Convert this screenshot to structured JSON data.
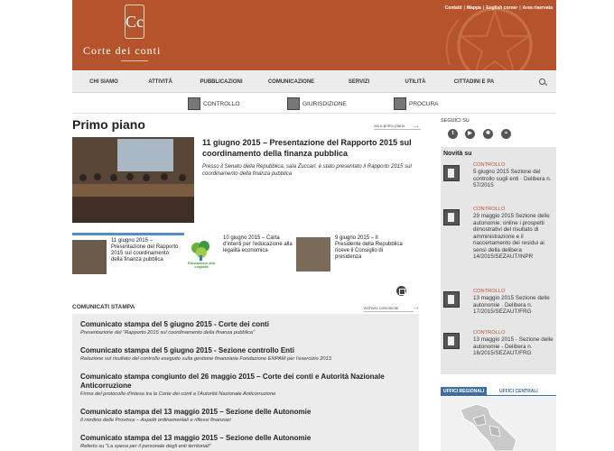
{
  "header": {
    "logo_mark": "Cc",
    "logo_text": "Corte dei conti",
    "top_links": [
      "Contatti",
      "Mappa",
      "English corner",
      "Area riservata"
    ],
    "brand_color": "#b5542c"
  },
  "nav": {
    "items": [
      "CHI SIAMO",
      "ATTIVITÀ",
      "PUBBLICAZIONI",
      "COMUNICAZIONE",
      "SERVIZI",
      "UTILITÀ",
      "CITTADINI E PA"
    ]
  },
  "subnav": {
    "items": [
      "CONTROLLO",
      "GIURISDIZIONE",
      "PROCURA"
    ]
  },
  "primo_piano": {
    "title": "Primo piano",
    "more_label": "vai a primo piano",
    "headline": "11 giugno 2015 – Presentazione del Rapporto 2015 sul coordinamento della finanza pubblica",
    "summary": "Presso il Senato della Repubblica, sala Zuccari, è stato presentato il Rapporto 2015 sul coordinamento della finanza pubblica",
    "items": [
      "11 giugno 2015 – Presentazione del Rapporto 2015 sul coordinamento della finanza pubblica",
      "10 giugno 2015 – Carta d'intenti per l'educazione alla legalità economica",
      "9 giugno 2015 – Il Presidente della Repubblica riceve il Consiglio di presidenza"
    ],
    "legality_logo_text": "Educazione alla Legalità"
  },
  "comunicati": {
    "title": "COMUNICATI STAMPA",
    "more_label": "archivio comunicati",
    "items": [
      {
        "title": "Comunicato stampa del 5 giugno 2015 - Corte dei conti",
        "subtitle": "Presentazione del \"Rapporto 2015 sul coordinamento della finanza pubblica\""
      },
      {
        "title": "Comunicato stampa del 5 giugno 2015 - Sezione controllo Enti",
        "subtitle": "Relazione sul risultato del controllo eseguito sulla gestione finanziaria Fondazione ENPAM per l'esercizio 2013"
      },
      {
        "title": "Comunicato stampa congiunto del 26 maggio 2015 – Corte dei conti e Autorità Nazionale Anticorruzione",
        "subtitle": "Firma del protocollo d'intesa tra la Corte dei conti e l'Autorità Nazionale Anticorruzione"
      },
      {
        "title": "Comunicato stampa del 13 maggio 2015 – Sezione delle Autonomie",
        "subtitle": "Il riordino delle Province – Aspetti ordinamentali e riflessi finanziari"
      },
      {
        "title": "Comunicato stampa del 13 maggio 2015 – Sezione delle Autonomie",
        "subtitle": "Referto su \"La spesa per il personale degli enti territoriali\""
      }
    ]
  },
  "sidebar": {
    "seguici": "SEGUICI SU",
    "social_icons": [
      "twitter-icon",
      "youtube-icon",
      "flickr-icon",
      "rss-icon"
    ],
    "novita_title": "Novità su",
    "novita": [
      {
        "category": "CONTROLLO",
        "text": "5 giugno 2015 Sezione del controllo sugli enti · Delibera n. 57/2015"
      },
      {
        "category": "CONTROLLO",
        "text": "29 maggio 2015 Sezione delle autonomie: online i prospetti dimostrativi del risultato di amministrazione e il riaccertamento dei residui ai sensi della delibera 14/2015/SEZAUT/INPR"
      },
      {
        "category": "CONTROLLO",
        "text": "13 maggio 2015 Sezione delle autonomie · Delibera n. 17/2015/SEZAUT/FRG"
      },
      {
        "category": "CONTROLLO",
        "text": "13 maggio 2015 - Sezione delle autonomie - Delibera n. 16/2015/SEZAUT/FRG"
      }
    ],
    "tabs": [
      "UFFICI REGIONALI",
      "UFFICI CENTRALI"
    ]
  }
}
